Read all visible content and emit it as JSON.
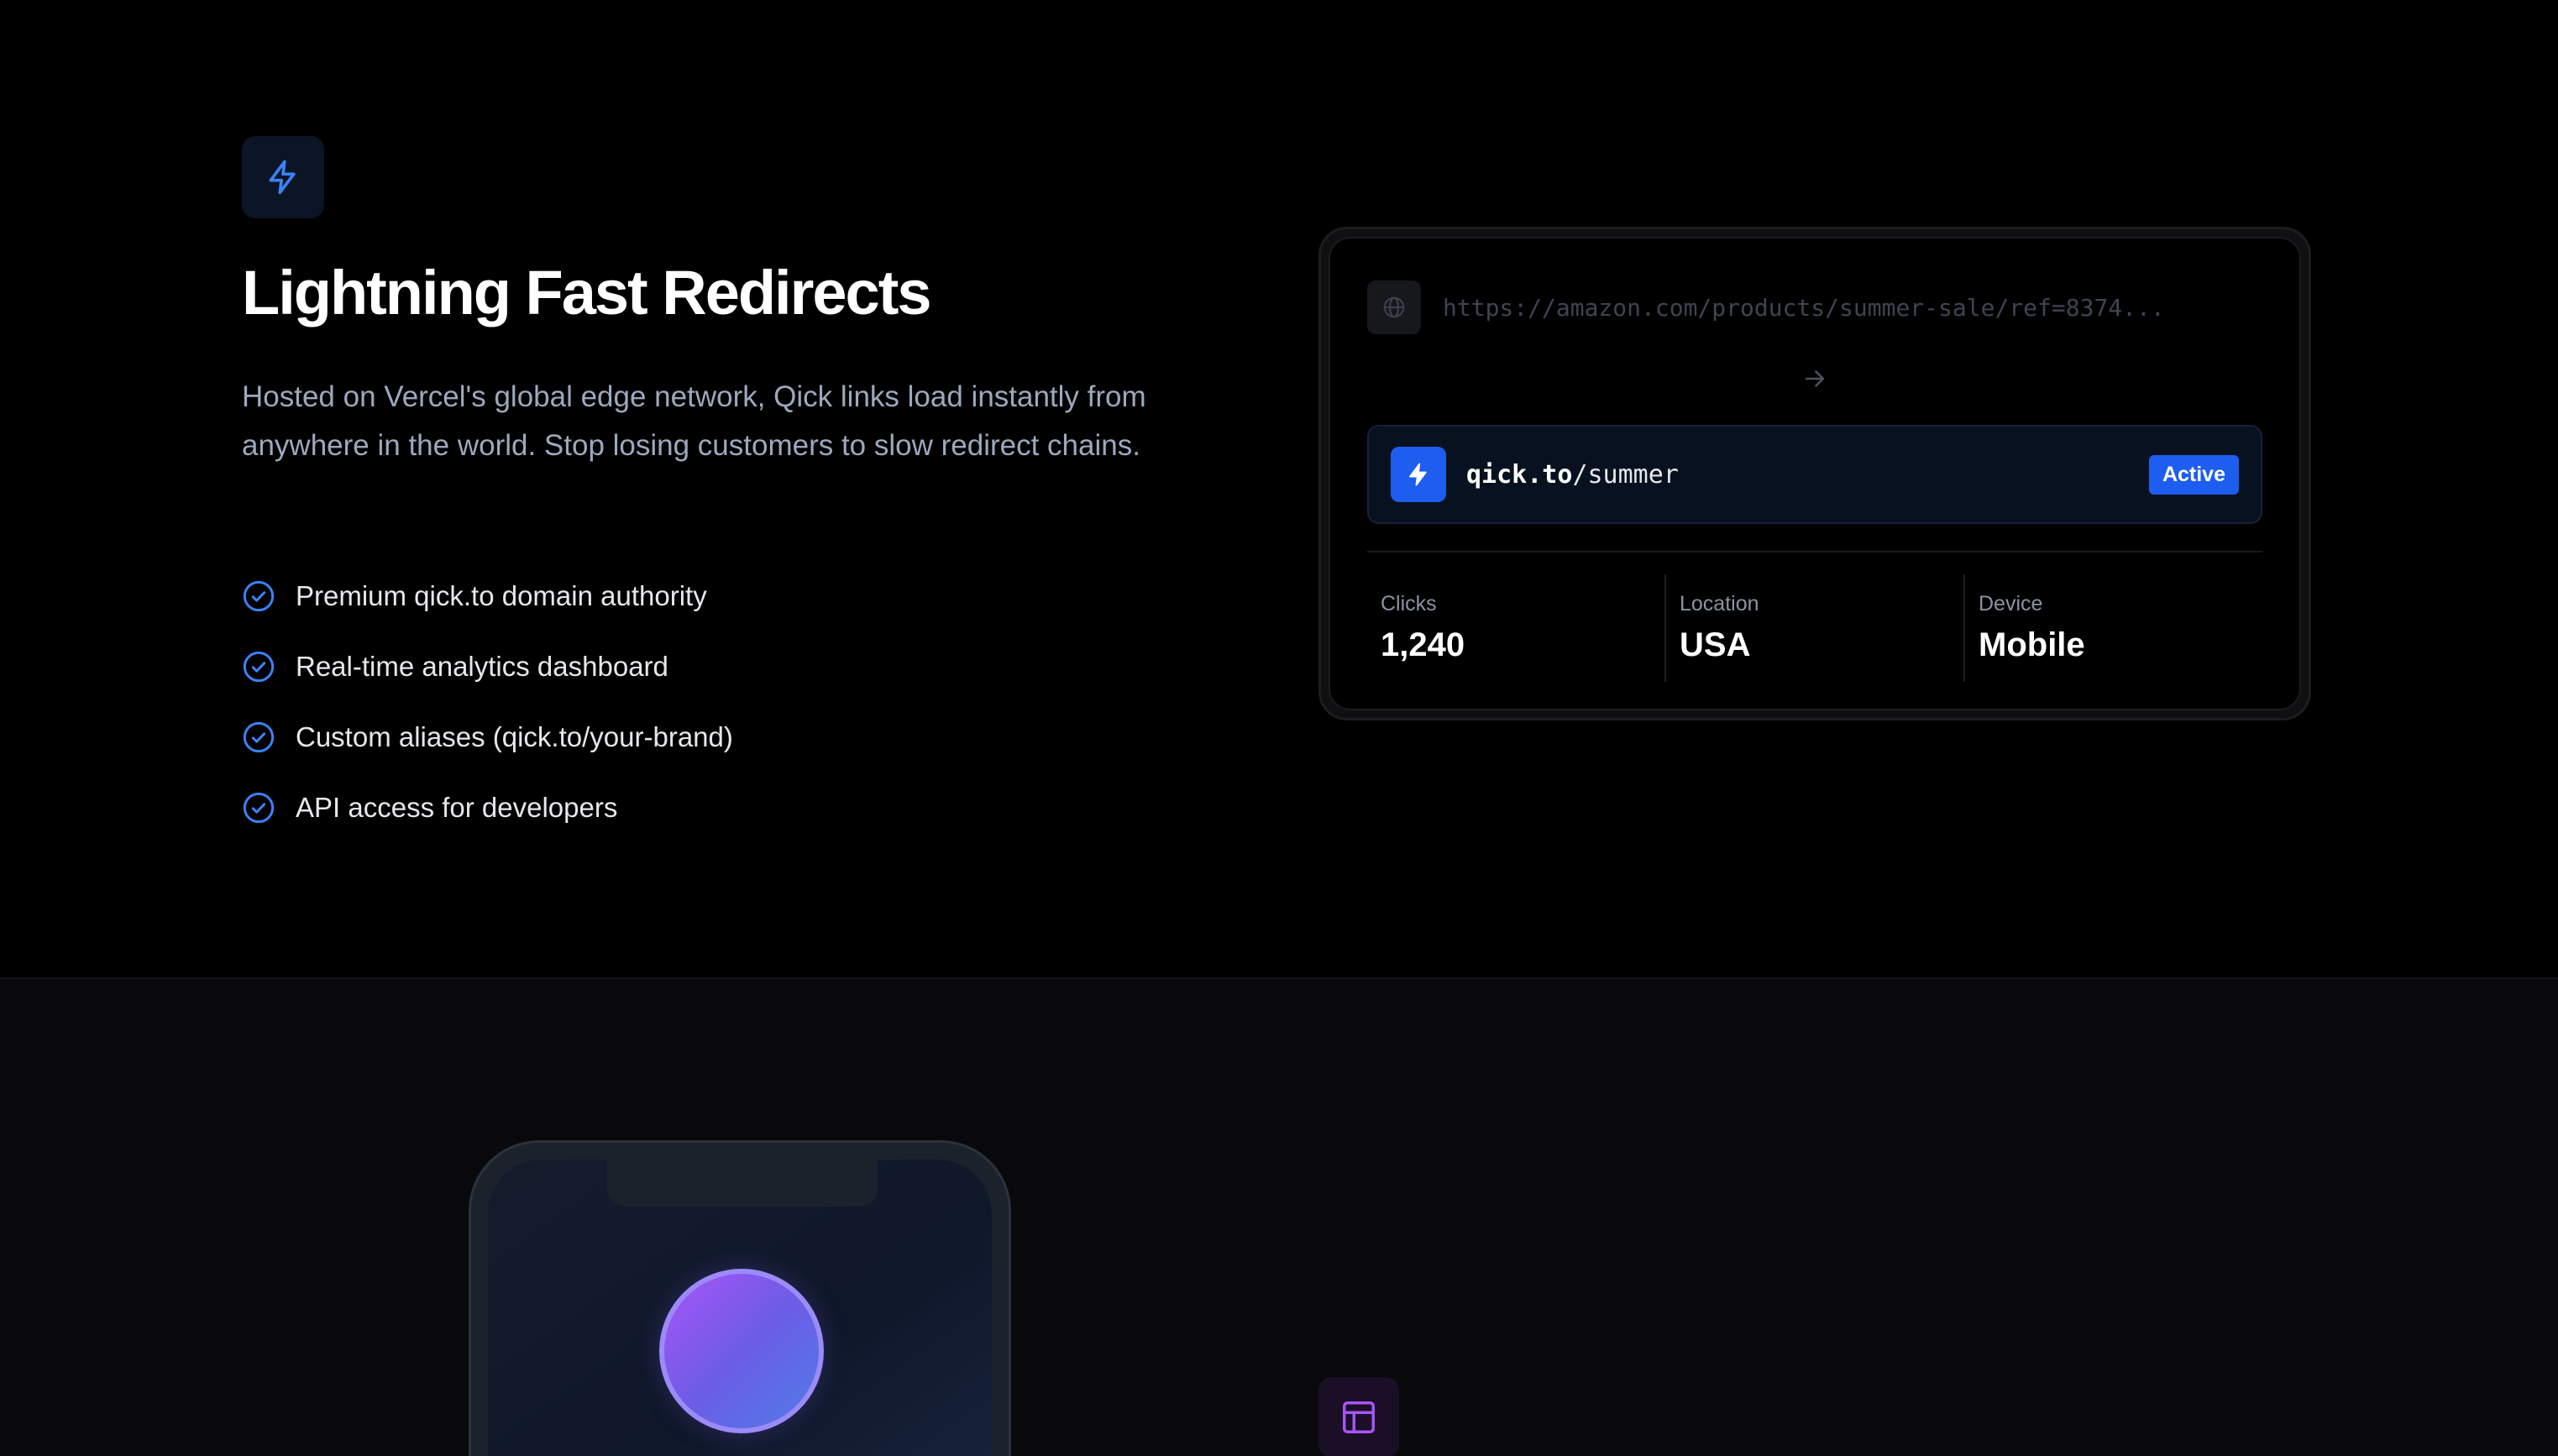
{
  "hero": {
    "icon": "bolt-icon",
    "title": "Lightning Fast Redirects",
    "description": "Hosted on Vercel's global edge network, Qick links load instantly from anywhere in the world. Stop losing customers to slow redirect chains.",
    "features": [
      "Premium qick.to domain authority",
      "Real-time analytics dashboard",
      "Custom aliases (qick.to/your-brand)",
      "API access for developers"
    ]
  },
  "demo_card": {
    "long_url": "https://amazon.com/products/summer-sale/ref=8374...",
    "short_domain": "qick.to",
    "short_path": "/summer",
    "status": "Active",
    "stats": [
      {
        "label": "Clicks",
        "value": "1,240"
      },
      {
        "label": "Location",
        "value": "USA"
      },
      {
        "label": "Device",
        "value": "Mobile"
      }
    ]
  },
  "colors": {
    "accent_blue": "#1d5ef0",
    "accent_purple": "#a855f7",
    "background": "#000000"
  },
  "next_section": {
    "icon": "layout-icon"
  }
}
